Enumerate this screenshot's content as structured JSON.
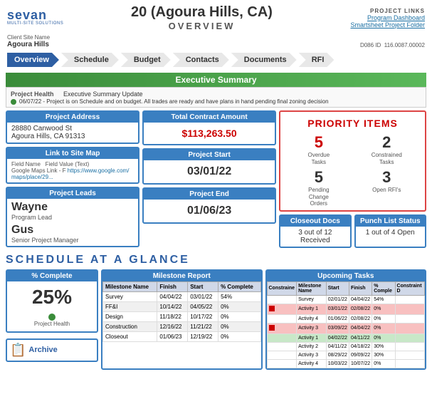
{
  "header": {
    "logo": "sevan",
    "logo_sub": "MULTI-SITE SOLUTIONS",
    "title": "20 (Agoura Hills, CA)",
    "subtitle": "OVERVIEW",
    "client_label": "Client Site Name",
    "client_name": "Agoura Hills",
    "d086_label": "D086 ID",
    "d086_id": "116.0087.00002",
    "project_links_title": "PROJECT LINKS",
    "link1": "Program Dashboard",
    "link2": "Smartsheet Project Folder"
  },
  "nav": {
    "tabs": [
      "Overview",
      "Schedule",
      "Budget",
      "Contacts",
      "Documents",
      "RFI"
    ]
  },
  "executive_summary": {
    "section_title": "Executive Summary",
    "health_label": "Project Health",
    "health_value": "Executive Summary Update",
    "note": "06/07/22 - Project is on Schedule and on budget. All trades are ready and have plans in hand pending final zoning decision"
  },
  "project_address": {
    "header": "Project Address",
    "line1": "28880 Canwood St",
    "line2": "Agoura Hills, CA 91313"
  },
  "total_contract": {
    "header": "Total Contract Amount",
    "amount": "$113,263.50"
  },
  "priority_items": {
    "header": "PRIORITY ITEMS",
    "items": [
      {
        "num": "5",
        "label": "Overdue\nTasks",
        "color": "red"
      },
      {
        "num": "2",
        "label": "Constrained\nTasks",
        "color": "normal"
      },
      {
        "num": "5",
        "label": "Pending\nChange\nOrders",
        "color": "normal"
      },
      {
        "num": "3",
        "label": "Open RFI's",
        "color": "normal"
      }
    ]
  },
  "link_to_site_map": {
    "header": "Link to Site Map",
    "field_label": "Field Name",
    "field_value": "Field Value (Text)",
    "maps_label": "Google Maps Link - F",
    "maps_url": "https://www.google.com/maps/place/29..."
  },
  "project_start": {
    "header": "Project Start",
    "date": "03/01/22"
  },
  "closeout_docs": {
    "header": "Closeout Docs",
    "value": "3 out of 12 Received"
  },
  "punch_list": {
    "header": "Punch List Status",
    "value": "1 out of 4 Open"
  },
  "project_leads": {
    "header": "Project Leads",
    "lead1_name": "Wayne",
    "lead1_role": "Program Lead",
    "lead2_name": "Gus",
    "lead2_role": "Senior Project Manager"
  },
  "project_end": {
    "header": "Project End",
    "date": "01/06/23"
  },
  "schedule": {
    "section_title": "SCHEDULE AT A GLANCE",
    "pct_complete_header": "% Complete",
    "pct_value": "25%",
    "project_health_label": "Project Health",
    "milestone_header": "Milestone Report",
    "milestone_columns": [
      "Milestone Name",
      "Finish",
      "Start",
      "% Complete"
    ],
    "milestones": [
      {
        "name": "Survey",
        "finish": "04/04/22",
        "start": "03/01/22",
        "pct": "54%"
      },
      {
        "name": "FF&I",
        "finish": "10/14/22",
        "start": "04/05/22",
        "pct": "0%"
      },
      {
        "name": "Design",
        "finish": "11/18/22",
        "start": "10/17/22",
        "pct": "0%"
      },
      {
        "name": "Construction",
        "finish": "12/16/22",
        "start": "11/21/22",
        "pct": "0%"
      },
      {
        "name": "Closeout",
        "finish": "01/06/23",
        "start": "12/19/22",
        "pct": "0%"
      }
    ],
    "upcoming_header": "Upcoming Tasks",
    "upcoming_columns": [
      "Constraine",
      "Milestone Name",
      "Start",
      "Finish",
      "% Comple",
      "Constraint D"
    ],
    "upcoming_tasks": [
      {
        "constraint": "",
        "name": "Survey",
        "start": "02/01/22",
        "finish": "04/04/22",
        "pct": "54%",
        "cdate": "",
        "row_class": "normal"
      },
      {
        "constraint": "red",
        "name": "Activity 1",
        "start": "03/01/22",
        "finish": "02/08/22",
        "pct": "0%",
        "cdate": "",
        "row_class": "red"
      },
      {
        "constraint": "",
        "name": "Activity 4",
        "start": "01/06/22",
        "finish": "02/08/22",
        "pct": "0%",
        "cdate": "",
        "row_class": "normal"
      },
      {
        "constraint": "red",
        "name": "Activity 3",
        "start": "03/09/22",
        "finish": "04/04/22",
        "pct": "0%",
        "cdate": "",
        "row_class": "red"
      },
      {
        "constraint": "",
        "name": "Activity 1",
        "start": "04/02/22",
        "finish": "04/11/22",
        "pct": "0%",
        "cdate": "",
        "row_class": "green"
      },
      {
        "constraint": "",
        "name": "Activity 2",
        "start": "04/11/22",
        "finish": "04/18/22",
        "pct": "30%",
        "cdate": "",
        "row_class": "normal"
      },
      {
        "constraint": "",
        "name": "Activity 3",
        "start": "08/29/22",
        "finish": "09/09/22",
        "pct": "30%",
        "cdate": "",
        "row_class": "normal"
      },
      {
        "constraint": "",
        "name": "Activity 4",
        "start": "10/03/22",
        "finish": "10/07/22",
        "pct": "0%",
        "cdate": "",
        "row_class": "normal"
      }
    ]
  },
  "archive": {
    "label": "Archive"
  }
}
